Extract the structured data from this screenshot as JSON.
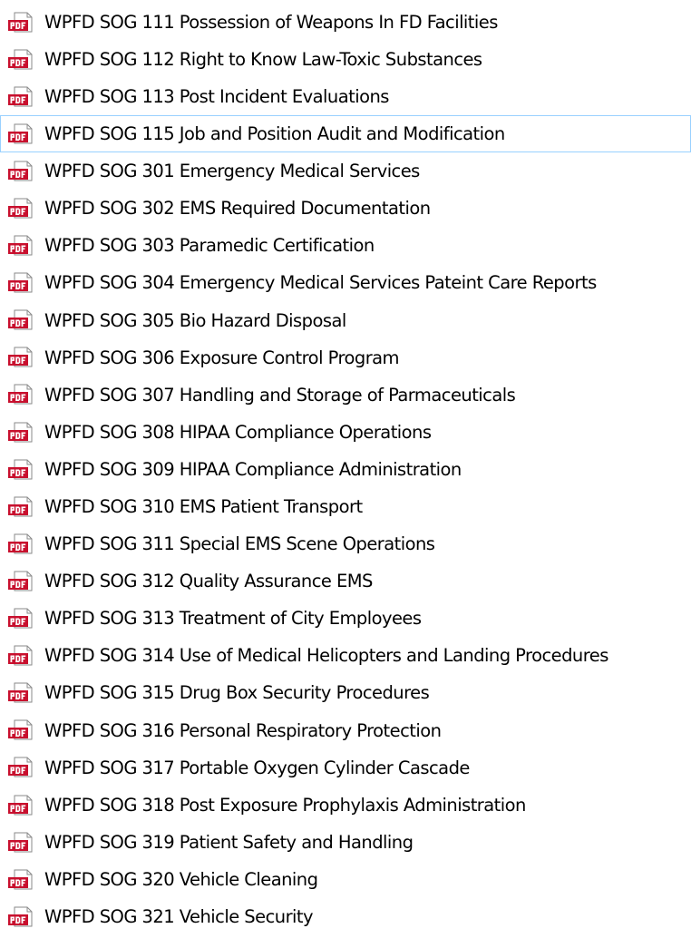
{
  "files": [
    {
      "name": "WPFD SOG 111 Possession of Weapons In FD Facilities",
      "icon": "pdf-file-icon"
    },
    {
      "name": "WPFD SOG 112 Right to Know Law-Toxic Substances",
      "icon": "pdf-file-icon"
    },
    {
      "name": "WPFD SOG 113 Post Incident Evaluations",
      "icon": "pdf-file-icon"
    },
    {
      "name": "WPFD SOG 115 Job and Position Audit and Modification",
      "icon": "pdf-file-icon",
      "selected": true
    },
    {
      "name": "WPFD SOG 301 Emergency Medical Services",
      "icon": "pdf-file-icon"
    },
    {
      "name": "WPFD SOG 302 EMS Required Documentation",
      "icon": "pdf-file-icon"
    },
    {
      "name": "WPFD SOG 303 Paramedic Certification",
      "icon": "pdf-file-icon"
    },
    {
      "name": "WPFD SOG 304 Emergency Medical Services Pateint Care Reports",
      "icon": "pdf-file-icon"
    },
    {
      "name": "WPFD SOG 305  Bio Hazard Disposal",
      "icon": "pdf-file-icon"
    },
    {
      "name": "WPFD SOG 306 Exposure Control Program",
      "icon": "pdf-file-icon"
    },
    {
      "name": "WPFD SOG 307 Handling and Storage of Parmaceuticals",
      "icon": "pdf-file-icon"
    },
    {
      "name": "WPFD SOG 308  HIPAA Compliance Operations",
      "icon": "pdf-file-icon"
    },
    {
      "name": "WPFD SOG 309 HIPAA Compliance Administration",
      "icon": "pdf-file-icon"
    },
    {
      "name": "WPFD SOG 310 EMS Patient Transport",
      "icon": "pdf-file-icon"
    },
    {
      "name": "WPFD SOG 311 Special EMS Scene Operations",
      "icon": "pdf-file-icon"
    },
    {
      "name": "WPFD SOG 312 Quality Assurance EMS",
      "icon": "pdf-file-icon"
    },
    {
      "name": "WPFD SOG 313 Treatment of City Employees",
      "icon": "pdf-file-icon"
    },
    {
      "name": "WPFD SOG 314 Use of Medical Helicopters and Landing Procedures",
      "icon": "pdf-file-icon"
    },
    {
      "name": "WPFD SOG 315 Drug Box Security Procedures",
      "icon": "pdf-file-icon"
    },
    {
      "name": "WPFD SOG 316 Personal Respiratory Protection",
      "icon": "pdf-file-icon"
    },
    {
      "name": "WPFD SOG 317 Portable Oxygen Cylinder Cascade",
      "icon": "pdf-file-icon"
    },
    {
      "name": "WPFD SOG 318 Post Exposure Prophylaxis Administration",
      "icon": "pdf-file-icon"
    },
    {
      "name": "WPFD SOG 319 Patient Safety and Handling",
      "icon": "pdf-file-icon"
    },
    {
      "name": "WPFD SOG 320 Vehicle Cleaning",
      "icon": "pdf-file-icon"
    },
    {
      "name": "WPFD SOG 321 Vehicle Security",
      "icon": "pdf-file-icon"
    }
  ],
  "colors": {
    "pdf_red": "#c8102e",
    "selection_border": "#99d1ff",
    "text": "#000000"
  }
}
